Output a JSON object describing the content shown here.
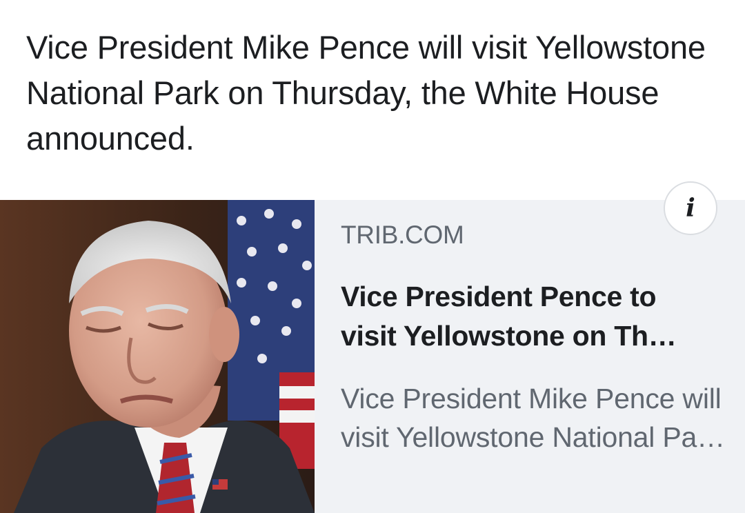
{
  "post": {
    "text": "Vice President Mike Pence will visit Yellowstone National Park on Thursday, the White House announced."
  },
  "link_card": {
    "domain": "TRIB.COM",
    "headline": "Vice President Pence to visit Yellowstone on Th…",
    "description": "Vice President Mike Pence will visit Yellowstone National Pa…",
    "info_icon": "i",
    "thumbnail_icon": "news-photo"
  },
  "colors": {
    "background": "#ffffff",
    "card_background": "#f0f2f5",
    "primary_text": "#1c1e21",
    "secondary_text": "#606770"
  }
}
